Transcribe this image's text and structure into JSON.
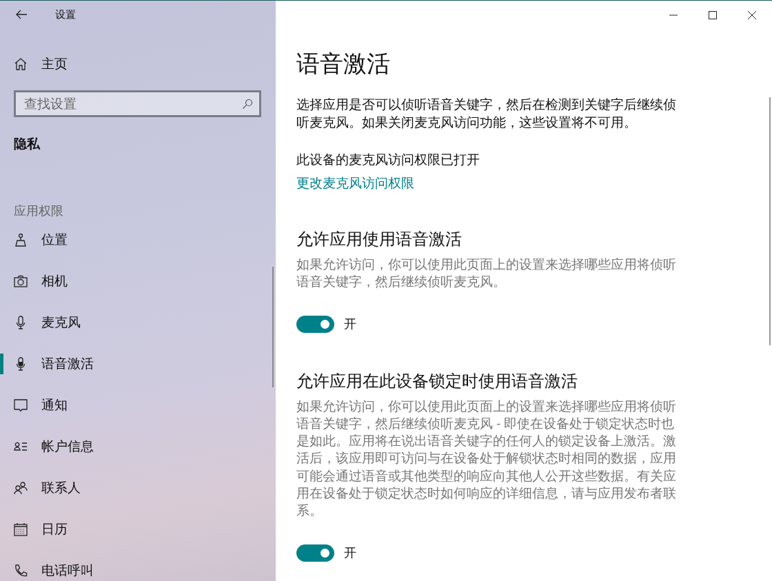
{
  "window": {
    "title": "设置"
  },
  "sidebar": {
    "home": "主页",
    "search": {
      "placeholder": "查找设置"
    },
    "section": "隐私",
    "group_label": "应用权限",
    "items": [
      {
        "label": "位置",
        "kind": "location",
        "selected": false
      },
      {
        "label": "相机",
        "kind": "camera",
        "selected": false
      },
      {
        "label": "麦克风",
        "kind": "microphone",
        "selected": false
      },
      {
        "label": "语音激活",
        "kind": "voice",
        "selected": true
      },
      {
        "label": "通知",
        "kind": "notification",
        "selected": false
      },
      {
        "label": "帐户信息",
        "kind": "account",
        "selected": false
      },
      {
        "label": "联系人",
        "kind": "contacts",
        "selected": false
      },
      {
        "label": "日历",
        "kind": "calendar",
        "selected": false
      },
      {
        "label": "电话呼叫",
        "kind": "phone",
        "selected": false
      }
    ]
  },
  "content": {
    "title": "语音激活",
    "description": "选择应用是否可以侦听语音关键字，然后在检测到关键字后继续侦听麦克风。如果关闭麦克风访问功能，这些设置将不可用。",
    "status": "此设备的麦克风访问权限已打开",
    "link": "更改麦克风访问权限",
    "sections": [
      {
        "heading": "允许应用使用语音激活",
        "description": "如果允许访问，你可以使用此页面上的设置来选择哪些应用将侦听语音关键字，然后继续侦听麦克风。",
        "toggle": {
          "on": true,
          "label": "开"
        }
      },
      {
        "heading": "允许应用在此设备锁定时使用语音激活",
        "description": "如果允许访问，你可以使用此页面上的设置来选择哪些应用将侦听语音关键字，然后继续侦听麦克风 - 即使在设备处于锁定状态时也是如此。应用将在说出语音关键字的任何人的锁定设备上激活。激活后，该应用即可访问与在设备处于解锁状态时相同的数据，应用可能会通过语音或其他类型的响应向其他人公开这些数据。有关应用在设备处于锁定状态时如何响应的详细信息，请与应用发布者联系。",
        "toggle": {
          "on": true,
          "label": "开"
        }
      }
    ]
  }
}
